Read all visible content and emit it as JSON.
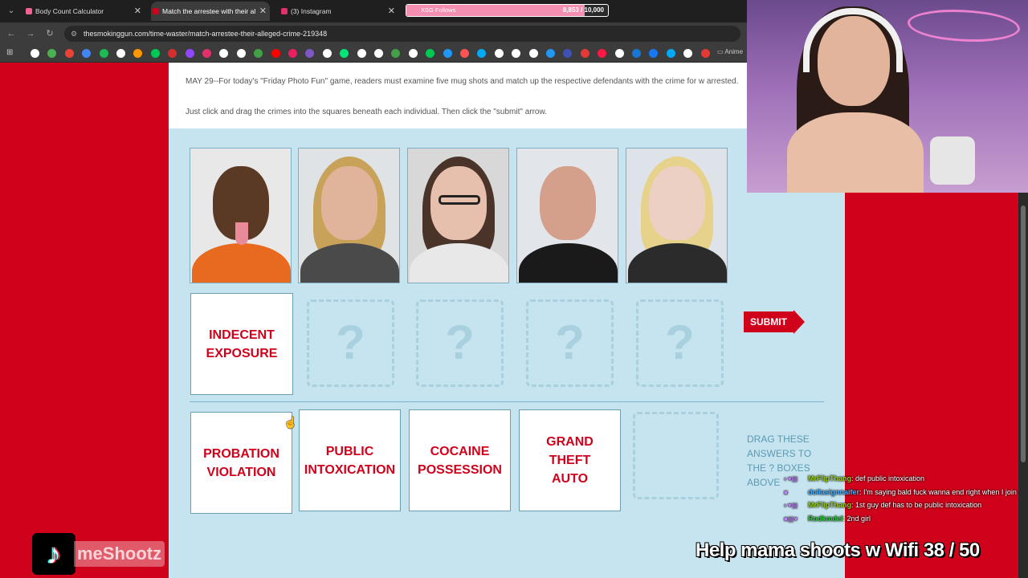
{
  "browser": {
    "tabs": [
      {
        "title": "Body Count Calculator",
        "favicon_color": "#f06292",
        "active": false
      },
      {
        "title": "Match the arrestee with their al",
        "favicon_color": "#d0021b",
        "active": true
      },
      {
        "title": "(3) Instagram",
        "favicon_color": "#e1306c",
        "active": false
      }
    ],
    "url": "thesmokinggun.com/time-waster/match-arrestee-their-alleged-crime-219348",
    "bookmarks_folder": "Anime",
    "bookmark_colors": [
      "#ffffff",
      "#4caf50",
      "#ea4335",
      "#4285f4",
      "#1db954",
      "#ffffff",
      "#ff9800",
      "#00c853",
      "#d32f2f",
      "#9146ff",
      "#e1306c",
      "#ffffff",
      "#ffffff",
      "#43a047",
      "#ff0000",
      "#e91e63",
      "#7e57c2",
      "#ffffff",
      "#00e676",
      "#ffffff",
      "#ffffff",
      "#43a047",
      "#ffffff",
      "#00c853",
      "#2196f3",
      "#ff5252",
      "#03a9f4",
      "#ffffff",
      "#ffffff",
      "#ffffff",
      "#2196f3",
      "#3f51b5",
      "#e53935",
      "#ff1744",
      "#ffffff",
      "#1976d2",
      "#1877f2",
      "#03a9f4",
      "#ffffff",
      "#e53935"
    ]
  },
  "overlay_goal": {
    "label": "XSG Follows",
    "count": "8,853 / 10,000",
    "progress": 0.8853
  },
  "article": {
    "intro": "MAY 29--For today's \"Friday Photo Fun\" game, readers must examine five mug shots and match up the respective defendants with the crime for w arrested.",
    "instructions": "Just click and drag the crimes into the squares beneath each individual. Then click the \"submit\" arrow."
  },
  "game": {
    "mugshots": [
      {
        "skin": "#5a3a25",
        "shirt": "#e86a1e",
        "bg": "#e8e8e8",
        "hair": null,
        "glasses": false,
        "tongue": true
      },
      {
        "skin": "#e0b49a",
        "shirt": "#4a4a4a",
        "bg": "#dfe3e6",
        "hair": "#c9a25a",
        "glasses": false,
        "tongue": false
      },
      {
        "skin": "#e6c0ac",
        "shirt": "#e8e8e8",
        "bg": "#d8d8d8",
        "hair": "#4a3328",
        "glasses": true,
        "tongue": false
      },
      {
        "skin": "#d4a08c",
        "shirt": "#1a1a1a",
        "bg": "#e2e6ea",
        "hair": null,
        "glasses": false,
        "tongue": false
      },
      {
        "skin": "#ecd0c4",
        "shirt": "#2b2b2b",
        "bg": "#dde3e8",
        "hair": "#e6d28a",
        "glasses": false,
        "tongue": false
      }
    ],
    "placed_answer": "INDECENT\nEXPOSURE",
    "empty_slot_symbol": "?",
    "submit_label": "SUBMIT",
    "answers": [
      "PROBATION\nVIOLATION",
      "PUBLIC\nINTOXICATION",
      "COCAINE\nPOSSESSION",
      "GRAND\nTHEFT\nAUTO"
    ],
    "hint": "DRAG THESE ANSWERS TO THE ? BOXES ABOVE"
  },
  "chat": [
    {
      "badges": "◐♥▤",
      "user": "MrFlipThang",
      "color": "#9ad11a",
      "message": ": def public intoxication"
    },
    {
      "badges": "■",
      "user": "dollasignnaifer",
      "color": "#4ab0ff",
      "message": ": I'm saying bald fuck wanna end right when I join"
    },
    {
      "badges": "◐♥▤",
      "user": "MrFlipThang",
      "color": "#9ad11a",
      "message": ": 1st guy def has to be public intoxication"
    },
    {
      "badges": "■▤♥",
      "user": "Rodkmdel",
      "color": "#2ecc40",
      "message": ": 2nd girl"
    }
  ],
  "stream_goal": "Help mama shoots w Wifi  38 / 50",
  "tiktok_handle": "meShootz"
}
